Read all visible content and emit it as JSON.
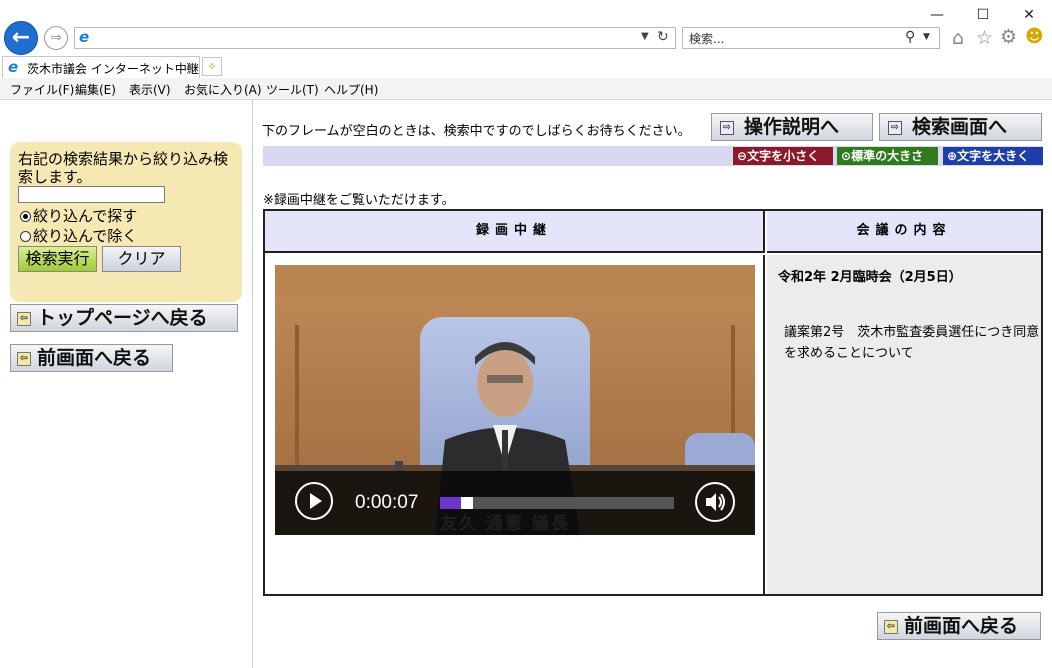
{
  "browser": {
    "search_placeholder": "検索...",
    "tab_title": "茨木市議会 インターネット中継",
    "tab_close": "×",
    "window_minimize": "—",
    "window_maximize": "☐",
    "window_close": "✕",
    "menu": [
      "ファイル(F)",
      "編集(E)",
      "表示(V)",
      "お気に入り(A)",
      "ツール(T)",
      "ヘルプ(H)"
    ]
  },
  "left": {
    "filter_text": "右記の検索結果から絞り込み検索します。",
    "filter_input_value": "",
    "radio_include": "絞り込んで探す",
    "radio_exclude": "絞り込んで除く",
    "search_button": "検索実行",
    "clear_button": "クリア",
    "top_page_button": "トップページへ戻る",
    "prev_button": "前画面へ戻る"
  },
  "right": {
    "wait_message": "下のフレームが空白のときは、検索中ですのでしばらくお待ちください。",
    "manual_button": "操作説明へ",
    "search_page_button": "検索画面へ",
    "text_smaller": "文字を小さく",
    "text_normal": "標準の大きさ",
    "text_larger": "文字を大きく",
    "notice": "※録画中継をご覧いただけます。",
    "col_recording": "録画中継",
    "col_meeting": "会議の内容",
    "meeting_title": "令和2年 2月臨時会（2月5日）",
    "meeting_description": "議案第2号　茨木市監査委員選任につき同意を求めることについて",
    "prev_button": "前画面へ戻る"
  },
  "video": {
    "time": "0:00:07",
    "caption": "友久 通憲 議長",
    "progress": 0.09
  },
  "colors": {
    "accent_blue": "#1f6fd1",
    "header_bg": "#e4e4fb",
    "filter_panel_bg": "#f5e8b2"
  }
}
